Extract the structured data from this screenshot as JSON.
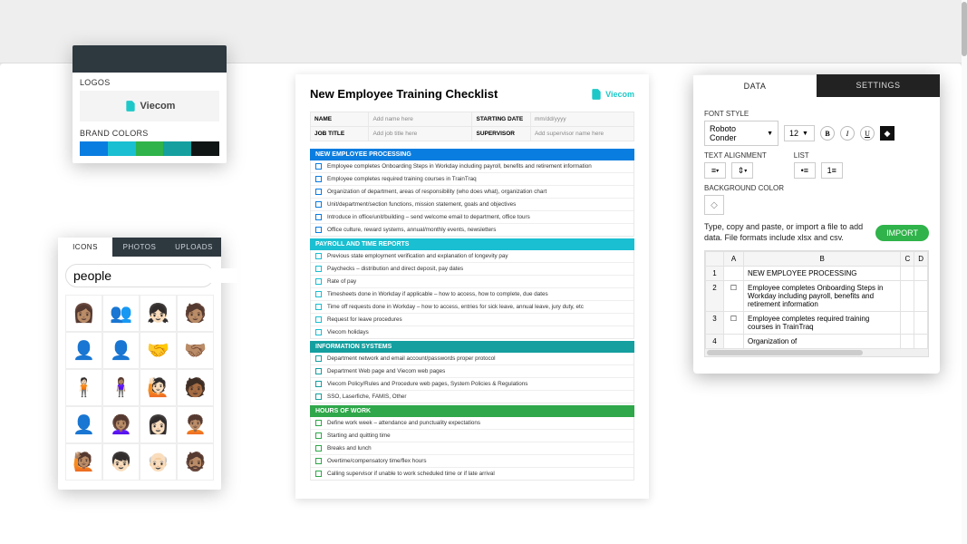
{
  "brand": {
    "logos_label": "LOGOS",
    "logo_text": "Viecom",
    "brandcolors_label": "BRAND COLORS",
    "swatches": [
      "#0a7de0",
      "#1abfd1",
      "#2fb34a",
      "#159f9f",
      "#0f1414"
    ]
  },
  "icon_panel": {
    "tabs": [
      "ICONS",
      "PHOTOS",
      "UPLOADS"
    ],
    "active_tab": 0,
    "search_value": "people"
  },
  "document": {
    "title": "New Employee Training Checklist",
    "brand_text": "Viecom",
    "meta": {
      "name_label": "NAME",
      "name_value": "Add name here",
      "start_label": "STARTING DATE",
      "start_value": "mm/dd/yyyy",
      "job_label": "JOB TITLE",
      "job_value": "Add job title here",
      "sup_label": "SUPERVISOR",
      "sup_value": "Add supervisor name here"
    },
    "sections": [
      {
        "title": "NEW EMPLOYEE PROCESSING",
        "style": "blue",
        "items": [
          "Employee completes Onboarding Steps in Workday including payroll, benefits and retirement information",
          "Employee completes required training courses in TrainTraq",
          "Organization of department, areas of responsibility (who does what), organization chart",
          "Unit/department/section functions, mission statement, goals and objectives",
          "Introduce in office/unit/building – send welcome email to department, office tours",
          "Office culture, reward systems, annual/monthly events, newsletters"
        ]
      },
      {
        "title": "PAYROLL AND TIME REPORTS",
        "style": "teal",
        "items": [
          "Previous state employment verification and explanation of longevity pay",
          "Paychecks – distribution and direct deposit, pay dates",
          "Rate of pay",
          "Timesheets done in Workday if applicable – how to access, how to complete, due dates",
          "Time off requests done in Workday – how to access, entries for sick leave, annual leave, jury duty, etc",
          "Request for leave procedures",
          "Viecom holidays"
        ]
      },
      {
        "title": "INFORMATION SYSTEMS",
        "style": "tealdk",
        "items": [
          "Department network and email account/passwords proper protocol",
          "Department Web page and Viecom web pages",
          "Viecom Policy/Rules and Procedure web pages, System Policies & Regulations",
          "SSO, Laserfiche, FAMIS, Other"
        ]
      },
      {
        "title": "HOURS OF WORK",
        "style": "green",
        "items": [
          "Define work week – attendance and punctuality expectations",
          "Starting and quitting time",
          "Breaks and lunch",
          "Overtime/compensatory time/flex hours",
          "Calling supervisor if unable to work scheduled time or if late arrival"
        ]
      }
    ]
  },
  "right": {
    "tabs": {
      "data": "DATA",
      "settings": "SETTINGS"
    },
    "labels": {
      "font_style": "FONT STYLE",
      "text_align": "TEXT ALIGNMENT",
      "list": "LIST",
      "bgcolor": "BACKGROUND COLOR"
    },
    "font_family": "Roboto Conder",
    "font_size": "12",
    "bold": "B",
    "italic": "I",
    "underline": "U",
    "instructions": "Type, copy and paste, or import a file to add data. File formats include xlsx and csv.",
    "import_label": "IMPORT",
    "cols": [
      "A",
      "B",
      "C",
      "D"
    ],
    "rows": [
      {
        "n": "1",
        "a": "",
        "b": "NEW EMPLOYEE PROCESSING"
      },
      {
        "n": "2",
        "a": "☐",
        "b": "Employee completes Onboarding Steps in Workday including payroll, benefits and retirement information"
      },
      {
        "n": "3",
        "a": "☐",
        "b": "Employee completes required training courses in TrainTraq"
      },
      {
        "n": "4",
        "a": "",
        "b": "Organization of"
      }
    ]
  }
}
